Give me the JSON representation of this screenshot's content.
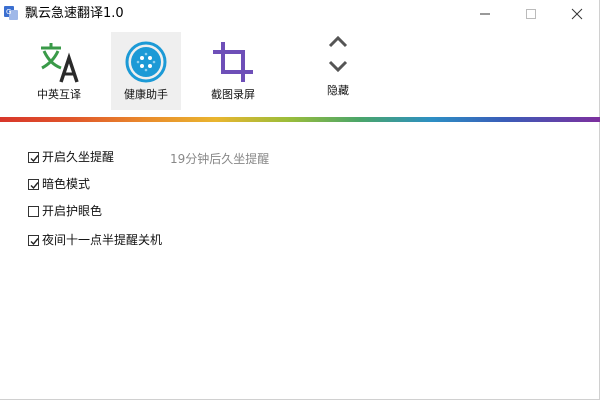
{
  "window": {
    "title": "飘云急速翻译1.0",
    "app_icon": "translate-app-icon"
  },
  "toolbar": {
    "items": [
      {
        "label": "中英互译",
        "icon": "translate-icon",
        "color": "#3a9a48",
        "active": false
      },
      {
        "label": "健康助手",
        "icon": "health-dots-icon",
        "color": "#1c9ad6",
        "active": true
      },
      {
        "label": "截图录屏",
        "icon": "crop-icon",
        "color": "#6e4fb8",
        "active": false
      },
      {
        "label": "隐藏",
        "icon": "chevron-up-down-icon",
        "color": "#555555",
        "active": false
      }
    ]
  },
  "options": [
    {
      "label": "开启久坐提醒",
      "checked": true
    },
    {
      "label": "暗色模式",
      "checked": true
    },
    {
      "label": "开启护眼色",
      "checked": false
    },
    {
      "label": "夜间十一点半提醒关机",
      "checked": true
    }
  ],
  "hint": "19分钟后久坐提醒"
}
